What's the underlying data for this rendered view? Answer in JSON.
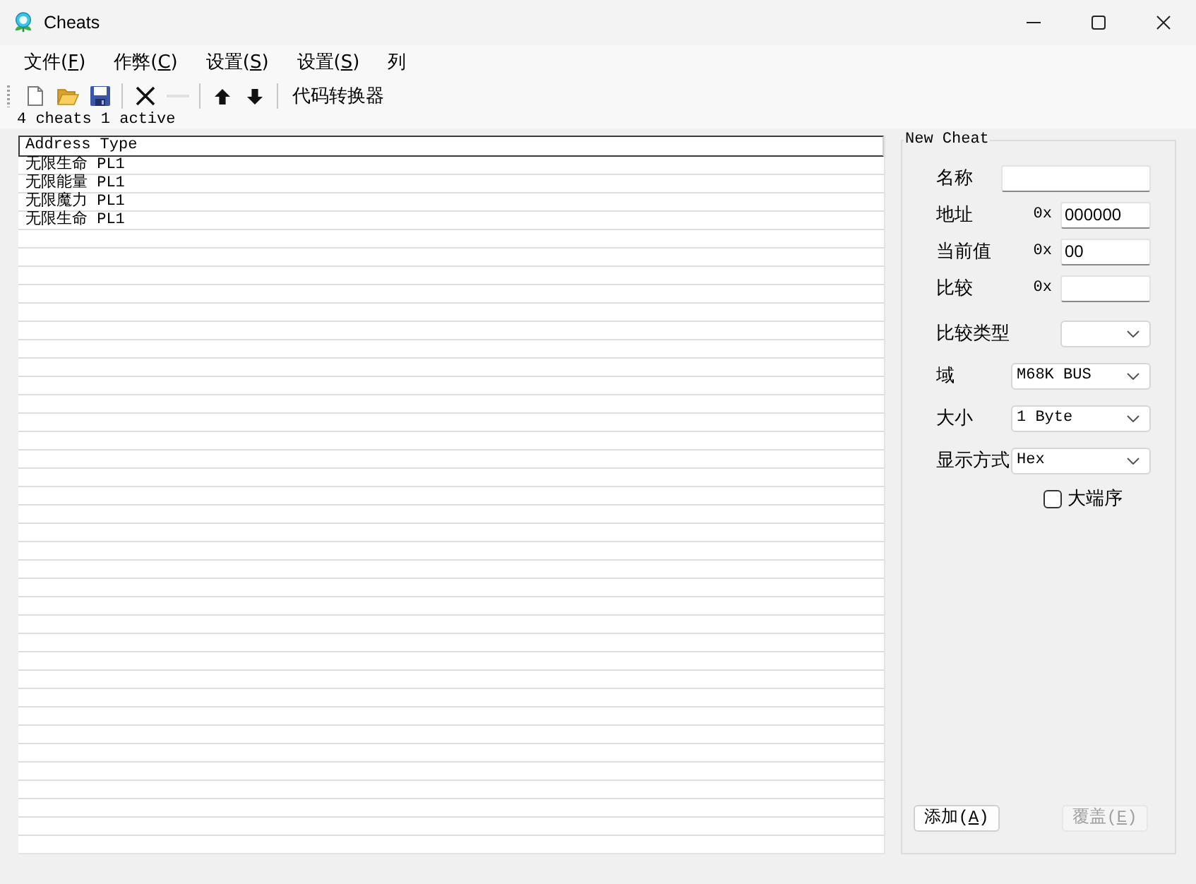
{
  "window": {
    "title": "Cheats"
  },
  "menu": [
    {
      "before": "文件(",
      "key": "F",
      "after": ")"
    },
    {
      "before": "作弊(",
      "key": "C",
      "after": ")"
    },
    {
      "before": "设置(",
      "key": "S",
      "after": ")"
    },
    {
      "before": "设置(",
      "key": "S",
      "after": ")"
    },
    {
      "before": "列"
    }
  ],
  "toolbar": {
    "groups": [
      [
        {
          "kind": "new",
          "disabled": false
        },
        {
          "kind": "open",
          "disabled": false
        },
        {
          "kind": "save",
          "disabled": false
        }
      ],
      [
        {
          "kind": "delete",
          "disabled": false
        },
        {
          "kind": "minus",
          "disabled": true
        }
      ],
      [
        {
          "kind": "up",
          "disabled": false
        },
        {
          "kind": "down",
          "disabled": false
        }
      ]
    ],
    "converter": "代码转换器"
  },
  "status": "4 cheats 1 active",
  "list": {
    "header": "Address Type",
    "rows": [
      "无限生命 PL1",
      "无限能量 PL1",
      "无限魔力 PL1",
      "无限生命 PL1"
    ]
  },
  "panel": {
    "title": "New Cheat",
    "fields": [
      {
        "kind": "text",
        "label": "名称"
      },
      {
        "kind": "hex",
        "label": "地址",
        "prefix": "0x",
        "value": "000000"
      },
      {
        "kind": "hex",
        "label": "当前值",
        "prefix": "0x",
        "value": "00"
      },
      {
        "kind": "hex",
        "label": "比较",
        "prefix": "0x"
      },
      {
        "kind": "operator",
        "label": "比较类型"
      },
      {
        "kind": "select",
        "label": "域",
        "value": "M68K BUS"
      },
      {
        "kind": "select",
        "label": "大小",
        "value": "1 Byte"
      },
      {
        "kind": "select",
        "label": "显示方式",
        "value": "Hex"
      },
      {
        "kind": "checkbox",
        "label": "大端序",
        "checked": false
      }
    ],
    "buttons": [
      {
        "before": "添加(",
        "key": "A",
        "after": ")",
        "disabled": false
      },
      {
        "before": "覆盖(",
        "key": "E",
        "after": ")",
        "disabled": true
      }
    ]
  }
}
